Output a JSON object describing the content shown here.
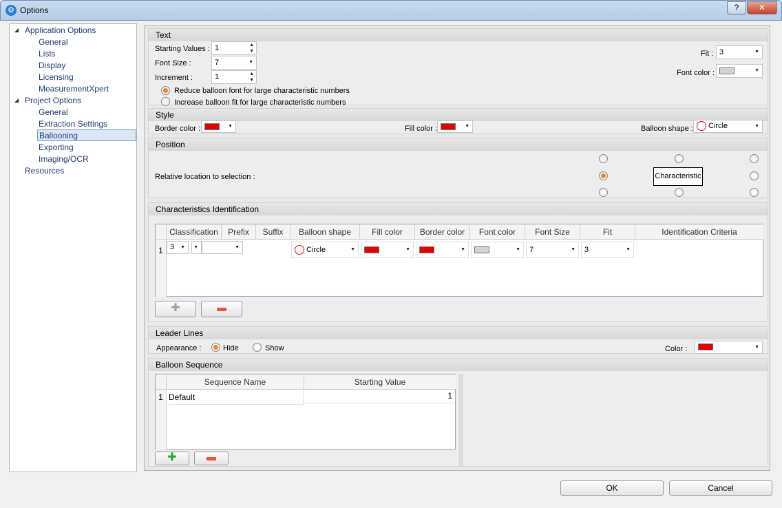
{
  "window": {
    "title": "Options",
    "help_label": "?",
    "close_label": "✕"
  },
  "tree": {
    "groups": [
      {
        "label": "Application Options",
        "children": [
          "General",
          "Lists",
          "Display",
          "Licensing",
          "MeasurementXpert"
        ]
      },
      {
        "label": "Project Options",
        "children": [
          "General",
          "Extraction Settings",
          "Ballooning",
          "Exporting",
          "Imaging/OCR"
        ]
      }
    ],
    "extra": "Resources",
    "selected": "Ballooning"
  },
  "text_section": {
    "title": "Text",
    "starting_values_label": "Starting Values :",
    "starting_values": "1",
    "font_size_label": "Font Size :",
    "font_size": "7",
    "increment_label": "Increment :",
    "increment": "1",
    "fit_label": "Fit :",
    "fit": "3",
    "font_color_label": "Font color :",
    "option_reduce": "Reduce balloon font for large characteristic numbers",
    "option_increase": "Increase balloon fit for large characteristic numbers"
  },
  "style_section": {
    "title": "Style",
    "border_color_label": "Border color :",
    "fill_color_label": "Fill color :",
    "balloon_shape_label": "Balloon shape :",
    "balloon_shape": "Circle"
  },
  "position_section": {
    "title": "Position",
    "relative_label": "Relative location to selection :",
    "center_label": "Characteristic"
  },
  "char_id_section": {
    "title": "Characteristics Identification",
    "columns": [
      "Classification",
      "Prefix",
      "Suffix",
      "Balloon shape",
      "Fill color",
      "Border color",
      "Font color",
      "Font Size",
      "Fit",
      "Identification Criteria"
    ],
    "row": {
      "num": "1",
      "classification": "3",
      "balloon_shape": "Circle",
      "font_size": "7",
      "fit": "3"
    }
  },
  "leader_section": {
    "title": "Leader Lines",
    "appearance_label": "Appearance :",
    "hide_label": "Hide",
    "show_label": "Show",
    "color_label": "Color :"
  },
  "sequence_section": {
    "title": "Balloon Sequence",
    "columns": [
      "Sequence Name",
      "Starting Value"
    ],
    "row": {
      "num": "1",
      "name": "Default",
      "value": "1"
    }
  },
  "buttons": {
    "ok": "OK",
    "cancel": "Cancel"
  },
  "colors": {
    "accent": "#f08a1c",
    "red": "#e00000",
    "selection": "#dbe7f7"
  }
}
